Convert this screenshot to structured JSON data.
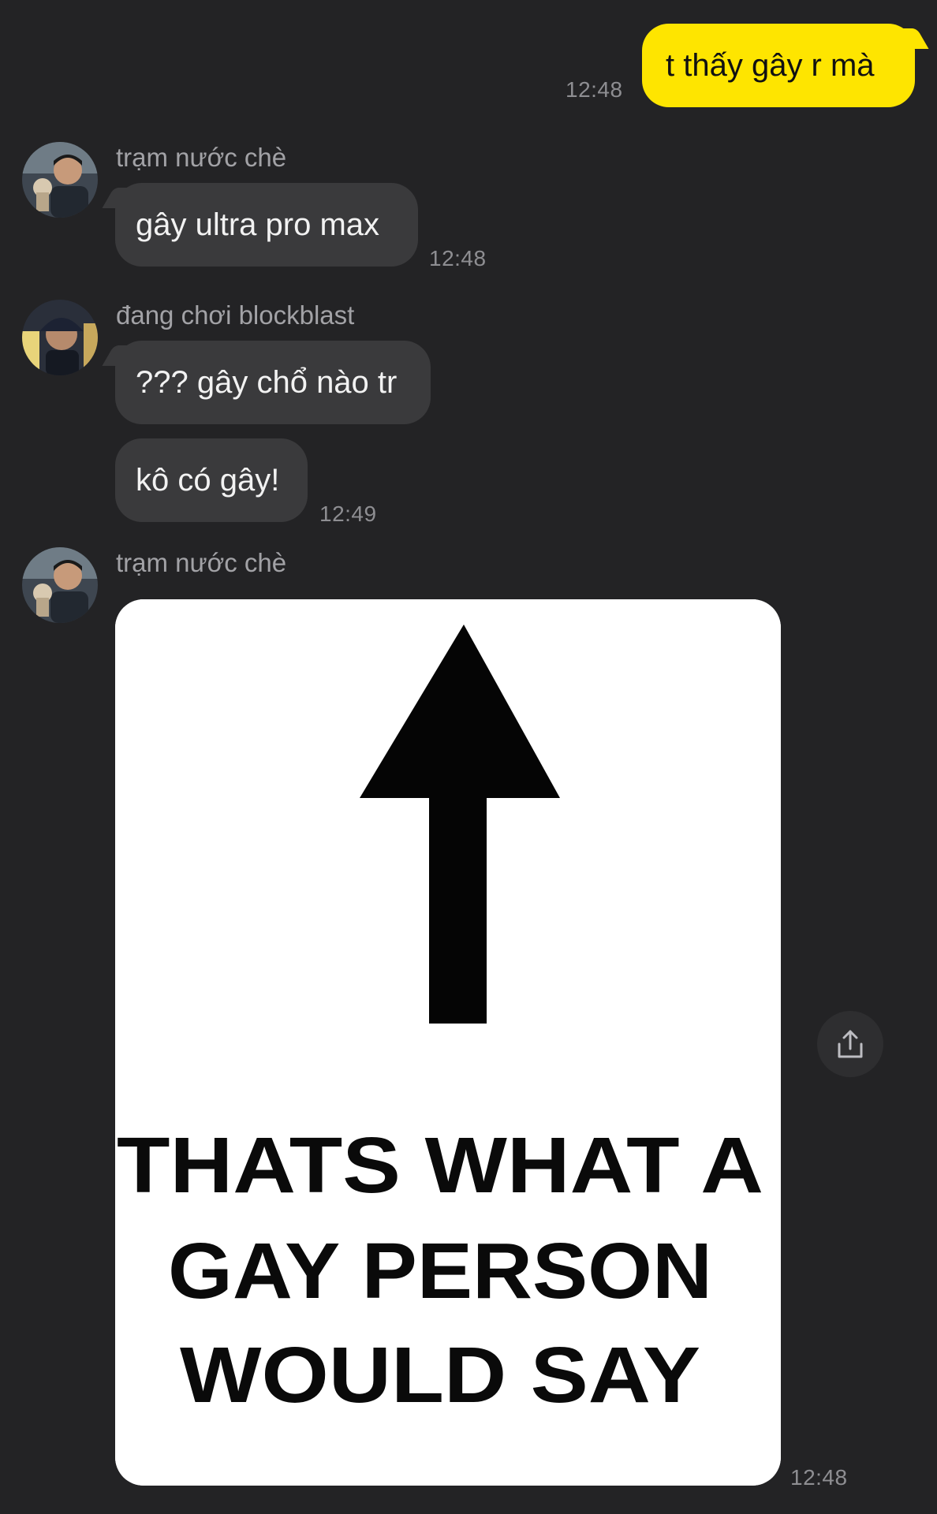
{
  "messages": [
    {
      "sender": "me",
      "text": "t thấy gây r mà",
      "time": "12:48"
    },
    {
      "sender": "trạm nước chè",
      "text": "gây ultra pro max",
      "time": "12:48"
    },
    {
      "sender": "đang chơi blockblast",
      "text": "??? gây chổ nào tr",
      "time": ""
    },
    {
      "sender": "đang chơi blockblast",
      "text": "kô có gây!",
      "time": "12:49"
    },
    {
      "sender": "trạm nước chè",
      "text": "",
      "time": "12:48",
      "attachment": "photo"
    }
  ],
  "users": {
    "tram": {
      "name": "trạm nước chè",
      "avatar_icon": "profile-photo"
    },
    "dang": {
      "name": "đang chơi blockblast",
      "avatar_icon": "profile-photo"
    }
  },
  "photo": {
    "caption_lines": [
      "THATS WHAT A",
      "GAY PERSON",
      "WOULD SAY"
    ],
    "icon": "up-arrow"
  },
  "share_button": {
    "icon": "share-icon"
  },
  "colors": {
    "background": "#232325",
    "my_bubble": "#fee500",
    "their_bubble": "#3a3a3c"
  }
}
